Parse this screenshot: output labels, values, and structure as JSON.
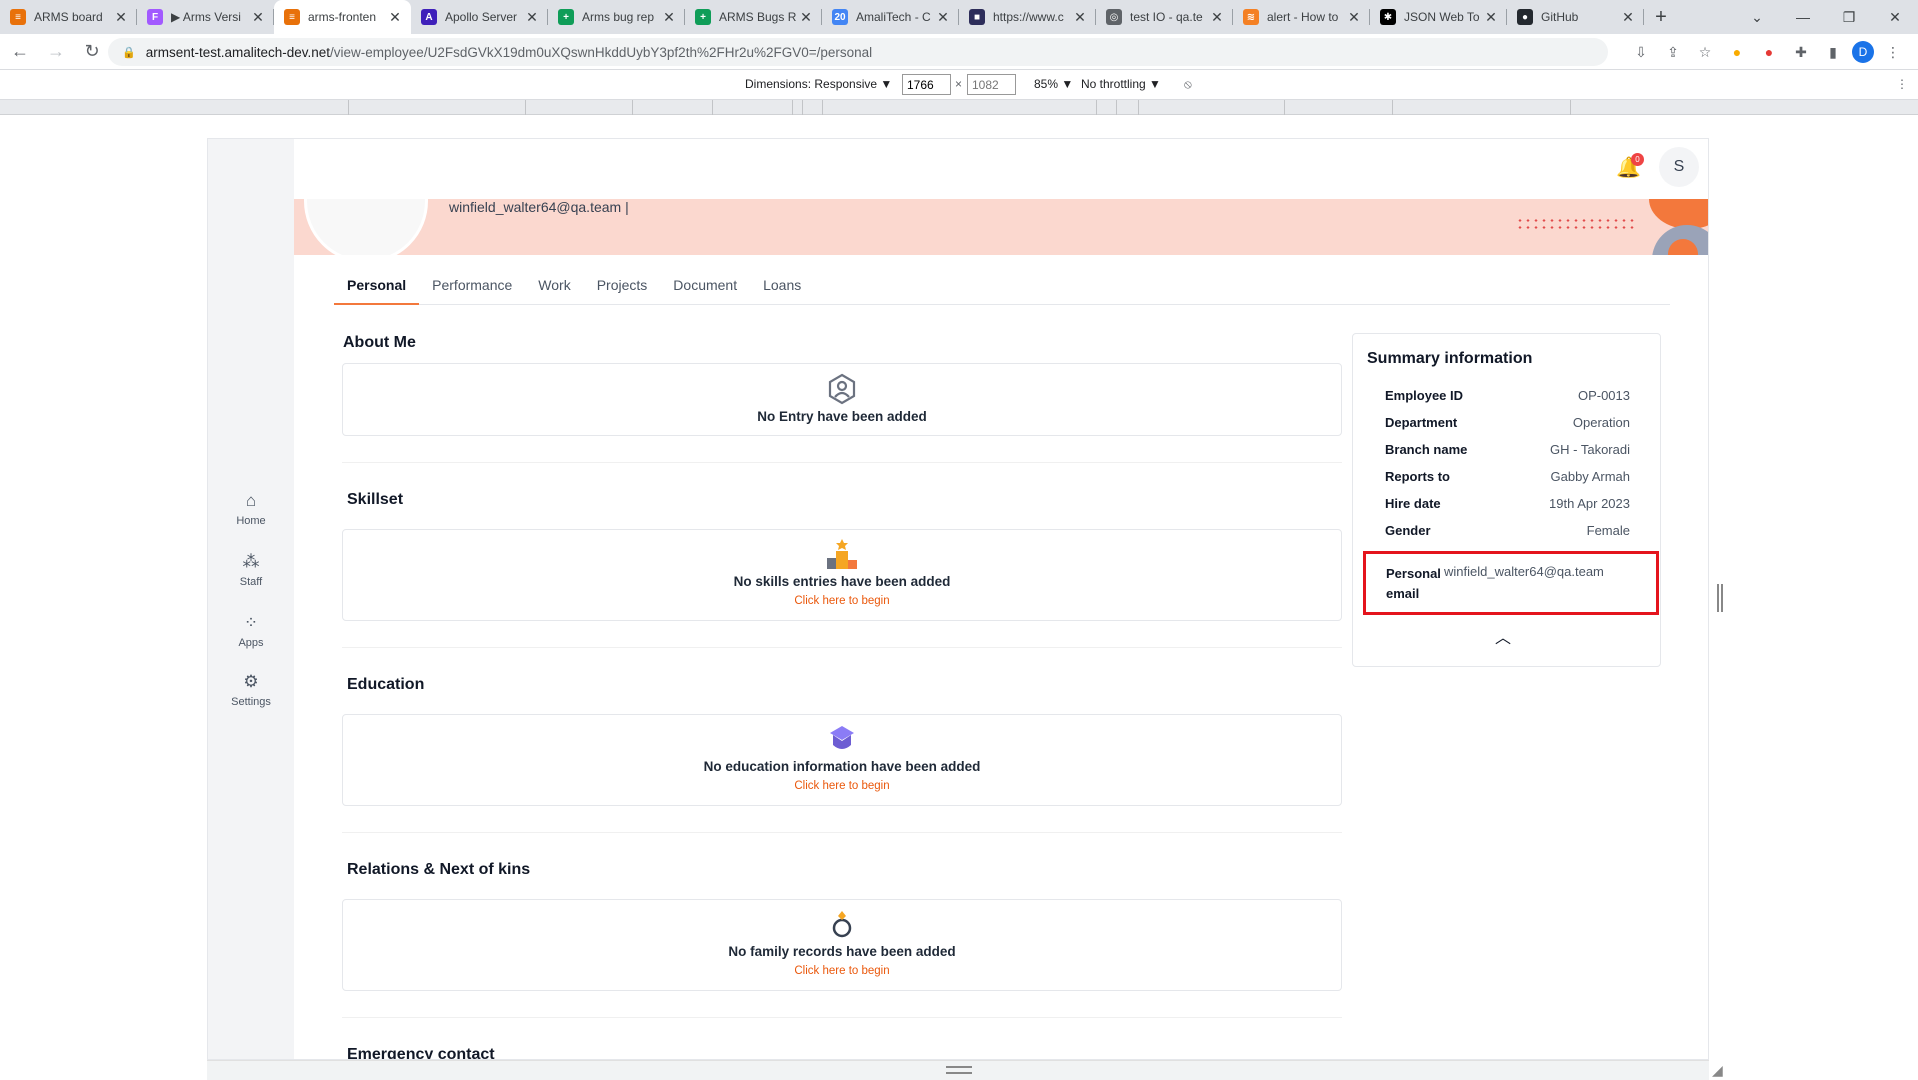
{
  "browser": {
    "tabs": [
      {
        "title": "ARMS board",
        "fav_color": "#e8710a",
        "fav_text": "≡"
      },
      {
        "title": "▶ Arms Versi",
        "fav_color": "#a259ff",
        "fav_text": "F"
      },
      {
        "title": "arms-fronten",
        "fav_color": "#e8710a",
        "fav_text": "≡",
        "active": true
      },
      {
        "title": "Apollo Server",
        "fav_color": "#3f20ba",
        "fav_text": "A"
      },
      {
        "title": "Arms bug rep",
        "fav_color": "#0f9d58",
        "fav_text": "+"
      },
      {
        "title": "ARMS Bugs R",
        "fav_color": "#0f9d58",
        "fav_text": "+"
      },
      {
        "title": "AmaliTech - C",
        "fav_color": "#4285f4",
        "fav_text": "20"
      },
      {
        "title": "https://www.c",
        "fav_color": "#2d2d5a",
        "fav_text": "■"
      },
      {
        "title": "test IO - qa.te",
        "fav_color": "#5f6368",
        "fav_text": "◎"
      },
      {
        "title": "alert - How to",
        "fav_color": "#f48024",
        "fav_text": "≋"
      },
      {
        "title": "JSON Web To",
        "fav_color": "#000000",
        "fav_text": "✱"
      },
      {
        "title": "GitHub",
        "fav_color": "#24292f",
        "fav_text": "●"
      }
    ],
    "url_host": "armsent-test.amalitech-dev.net",
    "url_path": "/view-employee/U2FsdGVkX19dm0uXQswnHkddUybY3pf2th%2FHr2u%2FGV0=/personal",
    "profile_letter": "D"
  },
  "devtools": {
    "dimensions_label": "Dimensions: Responsive ▼",
    "width": "1766",
    "height": "1082",
    "zoom": "85% ▼",
    "throttle": "No throttling ▼"
  },
  "sidebar": {
    "items": [
      {
        "label": "Home"
      },
      {
        "label": "Staff"
      },
      {
        "label": "Apps"
      },
      {
        "label": "Settings"
      }
    ]
  },
  "header": {
    "notification_count": "0",
    "user_initial": "S"
  },
  "profile": {
    "email": "winfield_walter64@qa.team |"
  },
  "tabs": [
    "Personal",
    "Performance",
    "Work",
    "Projects",
    "Document",
    "Loans"
  ],
  "sections": {
    "about": {
      "title": "About Me",
      "message": "No Entry have been added"
    },
    "skills": {
      "title": "Skillset",
      "message": "No skills entries have been added",
      "link": "Click here to begin"
    },
    "education": {
      "title": "Education",
      "message": "No education information have been added",
      "link": "Click here to begin"
    },
    "relations": {
      "title": "Relations & Next of kins",
      "message": "No family records have been added",
      "link": "Click here to begin"
    },
    "emergency": {
      "title": "Emergency contact"
    }
  },
  "summary": {
    "title": "Summary information",
    "rows": [
      {
        "key": "Employee ID",
        "value": "OP-0013"
      },
      {
        "key": "Department",
        "value": "Operation"
      },
      {
        "key": "Branch name",
        "value": "GH - Takoradi"
      },
      {
        "key": "Reports to",
        "value": "Gabby Armah"
      },
      {
        "key": "Hire date",
        "value": "19th Apr 2023"
      },
      {
        "key": "Gender",
        "value": "Female"
      }
    ],
    "email_key": "Personal email",
    "email_value": "winfield_walter64@qa.team"
  },
  "colors": {
    "accent": "#f3783c",
    "banner": "#fbd8cf",
    "highlight": "#e4141d",
    "link": "#ea580c"
  }
}
